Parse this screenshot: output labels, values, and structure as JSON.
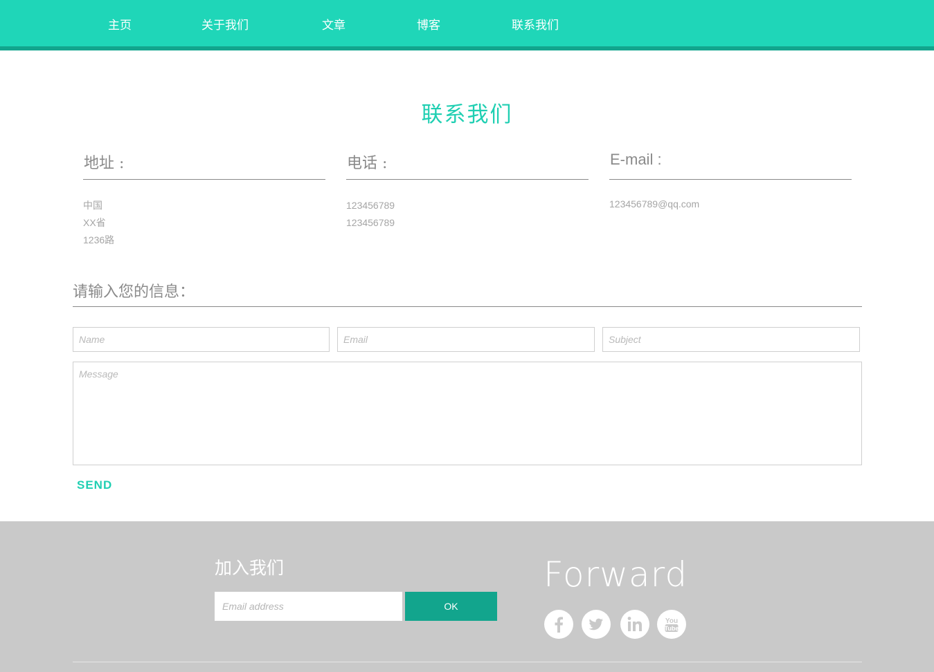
{
  "nav": {
    "items": [
      "主页",
      "关于我们",
      "文章",
      "博客",
      "联系我们"
    ]
  },
  "page_title": "联系我们",
  "info": {
    "address": {
      "label": "地址 :",
      "lines": [
        "中国",
        "XX省",
        "1236路"
      ]
    },
    "phone": {
      "label": "电话 :",
      "lines": [
        "123456789",
        "123456789"
      ]
    },
    "email": {
      "label": "E-mail :",
      "lines": [
        "123456789@qq.com"
      ]
    }
  },
  "form": {
    "heading": "请输入您的信息：",
    "name_placeholder": "Name",
    "email_placeholder": "Email",
    "subject_placeholder": "Subject",
    "message_placeholder": "Message",
    "send_label": "SEND"
  },
  "footer": {
    "join_title": "加入我们",
    "newsletter_placeholder": "Email address",
    "ok_label": "OK",
    "brand": "Forward",
    "social": [
      "facebook-icon",
      "twitter-icon",
      "linkedin-icon",
      "youtube-icon"
    ]
  },
  "colors": {
    "accent": "#1fd6b8",
    "accent_dark": "#12a58d",
    "footer_bg": "#c9c9c9"
  }
}
